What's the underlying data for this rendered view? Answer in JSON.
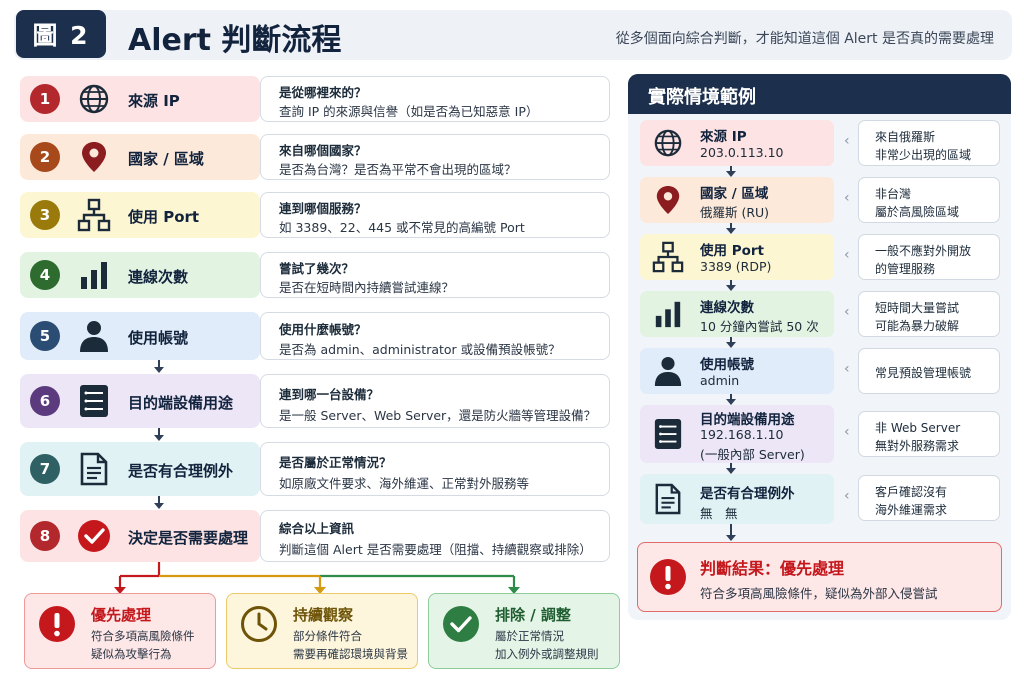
{
  "header": {
    "figure_label": "圖 2",
    "title": "Alert 判斷流程",
    "subtitle": "從多個面向綜合判斷，才能知道這個 Alert 是否真的需要處理"
  },
  "steps": [
    {
      "num": "1",
      "icon": "globe-icon",
      "title": "來源 IP",
      "question": "是從哪裡來的？",
      "detail": "查詢 IP 的來源與信譽（如是否為已知惡意 IP）"
    },
    {
      "num": "2",
      "icon": "location-pin-icon",
      "title": "國家 / 區域",
      "question": "來自哪個國家？",
      "detail": "是否為台灣？是否為平常不會出現的區域？"
    },
    {
      "num": "3",
      "icon": "network-icon",
      "title": "使用 Port",
      "question": "連到哪個服務？",
      "detail": "如 3389、22、445 或不常見的高編號 Port"
    },
    {
      "num": "4",
      "icon": "bar-chart-icon",
      "title": "連線次數",
      "question": "嘗試了幾次？",
      "detail": "是否在短時間內持續嘗試連線？"
    },
    {
      "num": "5",
      "icon": "user-icon",
      "title": "使用帳號",
      "question": "使用什麼帳號？",
      "detail": "是否為 admin、administrator 或設備預設帳號？"
    },
    {
      "num": "6",
      "icon": "server-icon",
      "title": "目的端設備用途",
      "question": "連到哪一台設備？",
      "detail": "是一般 Server、Web Server，還是防火牆等管理設備？"
    },
    {
      "num": "7",
      "icon": "document-icon",
      "title": "是否有合理例外",
      "question": "是否屬於正常情況？",
      "detail": "如原廠文件要求、海外維運、正常對外服務等"
    },
    {
      "num": "8",
      "icon": "check-circle-icon",
      "title": "決定是否需要處理",
      "question": "綜合以上資訊",
      "detail": "判斷這個 Alert 是否需要處理（阻擋、持續觀察或排除）"
    }
  ],
  "outcomes": [
    {
      "title": "優先處理",
      "line1": "符合多項高風險條件",
      "line2": "疑似為攻擊行為"
    },
    {
      "title": "持續觀察",
      "line1": "部分條件符合",
      "line2": "需要再確認環境與背景"
    },
    {
      "title": "排除 / 調整",
      "line1": "屬於正常情況",
      "line2": "加入例外或調整規則"
    }
  ],
  "example": {
    "title": "實際情境範例",
    "items": [
      {
        "title": "來源 IP",
        "value": "203.0.113.10",
        "note1": "來自俄羅斯",
        "note2": "非常少出現的區域"
      },
      {
        "title": "國家 / 區域",
        "value": "俄羅斯 (RU)",
        "note1": "非台灣",
        "note2": "屬於高風險區域"
      },
      {
        "title": "使用 Port",
        "value": "3389 (RDP)",
        "note1": "一般不應對外開放",
        "note2": "的管理服務"
      },
      {
        "title": "連線次數",
        "value": "10 分鐘內嘗試 50 次",
        "note1": "短時間大量嘗試",
        "note2": "可能為暴力破解"
      },
      {
        "title": "使用帳號",
        "value": "admin",
        "note1": "常見預設管理帳號",
        "note2": ""
      },
      {
        "title": "目的端設備用途",
        "value": "192.168.1.10",
        "value2": "(一般內部 Server)",
        "note1": "非 Web Server",
        "note2": "無對外服務需求"
      },
      {
        "title": "是否有合理例外",
        "value": "無　無",
        "note1": "客戶確認沒有",
        "note2": "海外維運需求"
      }
    ],
    "result": {
      "title": "判斷結果：優先處理",
      "desc": "符合多項高風險條件，疑似為外部入侵嘗試"
    }
  },
  "colors": {
    "step_red": "#fde3e3",
    "step_orange": "#fde9da",
    "step_yellow": "#fdf6d2",
    "step_green": "#e2f3e2",
    "step_blue": "#e0ecf9",
    "step_purple": "#ece6f7",
    "step_teal": "#e0f2f4",
    "num_red": "#b3282d",
    "num_orange": "#a8491c",
    "num_yellow": "#9a7a0a",
    "num_green": "#2e6b2e",
    "num_blue": "#2b4c73",
    "num_purple": "#5b3b7e",
    "num_teal": "#2f6063",
    "navy": "#1c2f4d"
  }
}
